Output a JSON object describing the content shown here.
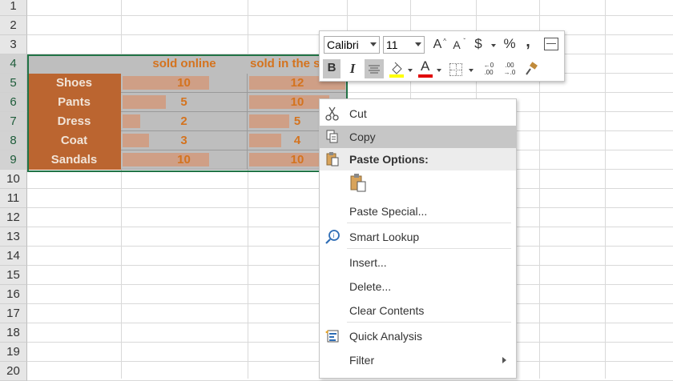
{
  "rows": [
    "1",
    "2",
    "3",
    "4",
    "5",
    "6",
    "7",
    "8",
    "9",
    "10",
    "11",
    "12",
    "13",
    "14",
    "15",
    "16",
    "17",
    "18",
    "19",
    "20"
  ],
  "table": {
    "headers": [
      "sold online",
      "sold in the s"
    ],
    "items": [
      {
        "label": "Shoes",
        "online": "10",
        "store": "12"
      },
      {
        "label": "Pants",
        "online": "5",
        "store": "10"
      },
      {
        "label": "Dress",
        "online": "2",
        "store": "5"
      },
      {
        "label": "Coat",
        "online": "3",
        "store": "4"
      },
      {
        "label": "Sandals",
        "online": "10",
        "store": "10"
      }
    ],
    "colors": {
      "label_fill": "#bb6530",
      "value_fill": "#bebebe",
      "bar_fill": "#cf9f86",
      "text_orange": "#d4731e",
      "selection": "#217346"
    }
  },
  "mini_toolbar": {
    "font_name": "Calibri",
    "font_size": "11",
    "grow_font": "A",
    "shrink_font": "A",
    "currency": "$",
    "percent": "%",
    "comma": ",",
    "bold": "B",
    "italic": "I",
    "inc_decimal_top": "←0",
    "inc_decimal_bottom": ".00",
    "dec_decimal_top": ".00",
    "dec_decimal_bottom": "→.0",
    "font_color_letter": "A",
    "fill_color": "#ffff00",
    "font_color": "#e00000"
  },
  "context_menu": {
    "items": [
      {
        "label": "Cut",
        "icon": "scissors-icon"
      },
      {
        "label": "Copy",
        "icon": "copy-icon"
      },
      {
        "label": "Paste Options:",
        "icon": "paste-icon"
      },
      {
        "label": "Paste Special..."
      },
      {
        "label": "Smart Lookup",
        "icon": "smart-lookup-icon"
      },
      {
        "label": "Insert..."
      },
      {
        "label": "Delete..."
      },
      {
        "label": "Clear Contents"
      },
      {
        "label": "Quick Analysis",
        "icon": "quick-analysis-icon"
      },
      {
        "label": "Filter"
      }
    ]
  }
}
